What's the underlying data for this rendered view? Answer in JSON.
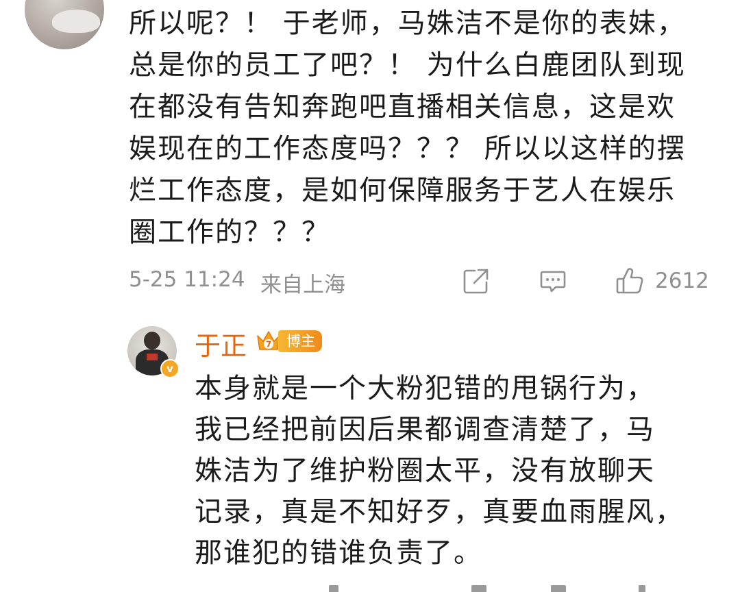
{
  "comment": {
    "lines": [
      "所以呢？！ 于老师，马姝洁不是你的表妹，",
      "总是你的员工了吧？！ 为什么白鹿团队到现",
      "在都没有告知奔跑吧直播相关信息，这是欢",
      "娱现在的工作态度吗？？？ 所以以这样的摆",
      "烂工作态度，是如何保障服务于艺人在娱乐",
      "圈工作的？？？"
    ],
    "time": "5-25 11:24",
    "location": "来自上海",
    "like_count": "2612"
  },
  "reply": {
    "name": "于正",
    "badge": "博主",
    "crown_level": "7",
    "verified_mark": "v",
    "lines": [
      "本身就是一个大粉犯错的甩锅行为，",
      "我已经把前因后果都调查清楚了，马",
      "姝洁为了维护粉圈太平，没有放聊天",
      "记录，真是不知好歹，真要血雨腥风，",
      "那谁犯的错谁负责了。"
    ]
  },
  "colors": {
    "text": "#1b1b1b",
    "meta": "#8f8f8f",
    "name_orange": "#e8630a",
    "badge_gradient_start": "#f7b733",
    "badge_gradient_end": "#f08a1c"
  },
  "icons": {
    "share": "share-icon",
    "reply": "comment-icon",
    "like": "thumbs-up-icon",
    "crown": "crown-icon"
  }
}
